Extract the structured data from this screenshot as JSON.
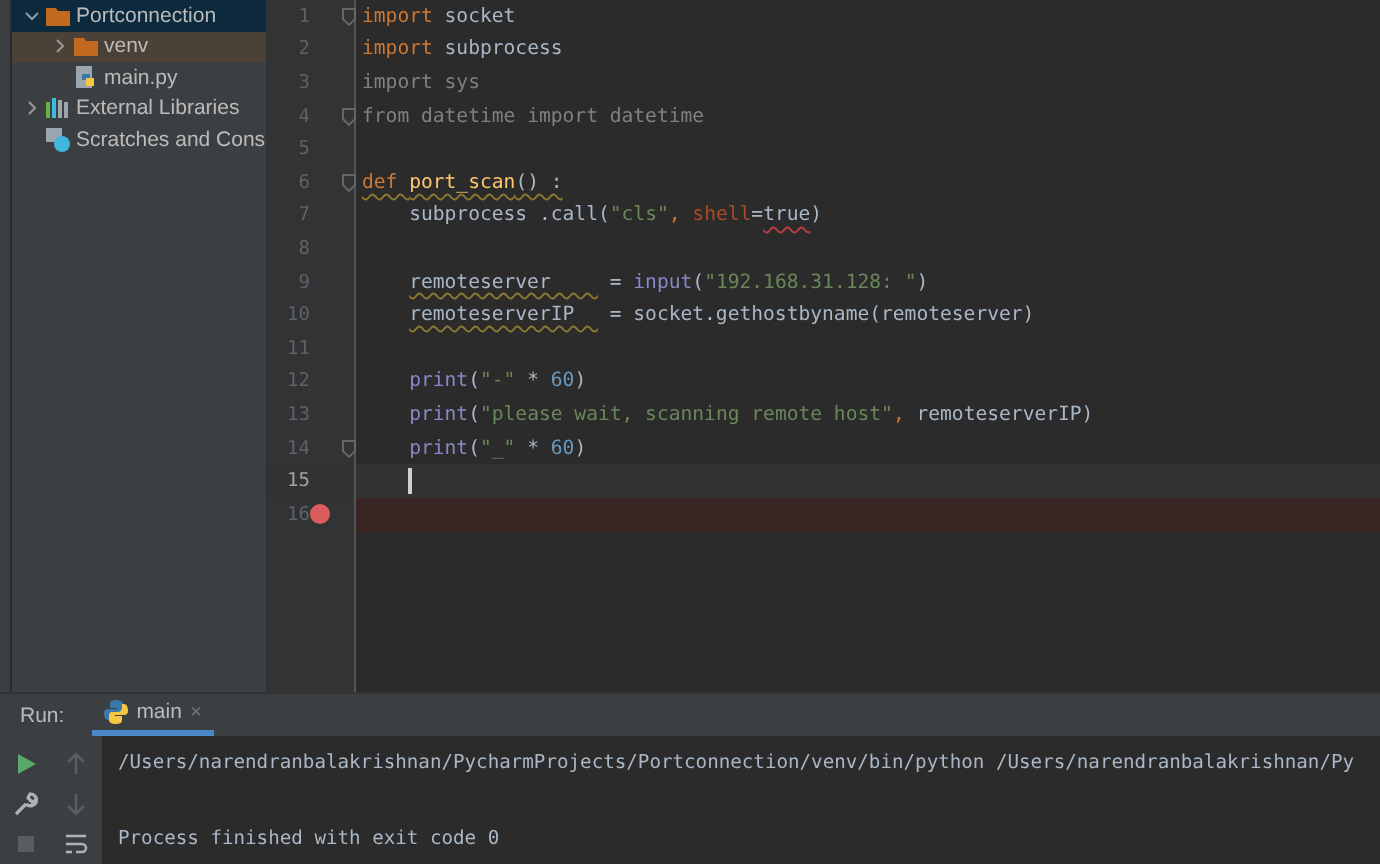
{
  "project_tree": [
    {
      "label": "Portconnection",
      "kind": "folder",
      "expanded": true,
      "selected": true,
      "children": [
        {
          "label": "venv",
          "kind": "folder",
          "expanded": false,
          "selected": false,
          "highlighted": true
        },
        {
          "label": "main.py",
          "kind": "python",
          "selected": false
        }
      ]
    },
    {
      "label": "External Libraries",
      "kind": "library",
      "expanded": false,
      "selected": false
    },
    {
      "label": "Scratches and Cons",
      "kind": "scratch",
      "selected": false
    }
  ],
  "editor": {
    "lines": [
      {
        "number": "1",
        "fold": true,
        "tokens": [
          {
            "text": "import",
            "kind": "keyword"
          },
          {
            "text": " socket",
            "kind": "plain"
          }
        ]
      },
      {
        "number": "2",
        "tokens": [
          {
            "text": "import",
            "kind": "keyword"
          },
          {
            "text": " subprocess",
            "kind": "plain"
          }
        ]
      },
      {
        "number": "3",
        "tokens": [
          {
            "text": "import sys",
            "kind": "unused"
          }
        ]
      },
      {
        "number": "4",
        "fold": true,
        "tokens": [
          {
            "text": "from datetime import datetime",
            "kind": "unused"
          }
        ]
      },
      {
        "number": "5"
      },
      {
        "number": "6",
        "fold": true,
        "tokens": [
          {
            "text": "def ",
            "kind": "keyword_warn"
          },
          {
            "text": "port_scan",
            "kind": "function_warn"
          },
          {
            "text": "() :",
            "kind": "plain_warn"
          }
        ]
      },
      {
        "number": "7",
        "tokens": [
          {
            "text": "    subprocess .call(",
            "kind": "plain"
          },
          {
            "text": "\"cls\"",
            "kind": "string"
          },
          {
            "text": ", ",
            "kind": "keyword"
          },
          {
            "text": "shell",
            "kind": "param"
          },
          {
            "text": "=",
            "kind": "plain"
          },
          {
            "text": "true",
            "kind": "error"
          },
          {
            "text": ")",
            "kind": "plain"
          }
        ]
      },
      {
        "number": "8"
      },
      {
        "number": "9",
        "indented": true,
        "tokens": [
          {
            "text": "remoteserver    ",
            "kind": "plain_warn"
          },
          {
            "text": " = ",
            "kind": "plain"
          },
          {
            "text": "input",
            "kind": "builtin"
          },
          {
            "text": "(",
            "kind": "plain"
          },
          {
            "text": "\"192.168.31.128: \"",
            "kind": "string"
          },
          {
            "text": ")",
            "kind": "plain"
          }
        ]
      },
      {
        "number": "10",
        "indented": true,
        "tokens": [
          {
            "text": "remoteserverIP  ",
            "kind": "plain_warn"
          },
          {
            "text": " = socket.gethostbyname(remoteserver)",
            "kind": "plain"
          }
        ]
      },
      {
        "number": "11"
      },
      {
        "number": "12",
        "indented": true,
        "tokens": [
          {
            "text": "print",
            "kind": "builtin"
          },
          {
            "text": "(",
            "kind": "plain"
          },
          {
            "text": "\"-\"",
            "kind": "string"
          },
          {
            "text": " * ",
            "kind": "plain"
          },
          {
            "text": "60",
            "kind": "number"
          },
          {
            "text": ")",
            "kind": "plain"
          }
        ]
      },
      {
        "number": "13",
        "indented": true,
        "tokens": [
          {
            "text": "print",
            "kind": "builtin"
          },
          {
            "text": "(",
            "kind": "plain"
          },
          {
            "text": "\"please wait, scanning remote host\"",
            "kind": "string"
          },
          {
            "text": ", ",
            "kind": "keyword"
          },
          {
            "text": "remoteserverIP)",
            "kind": "plain"
          }
        ]
      },
      {
        "number": "14",
        "fold": true,
        "indented": true,
        "tokens": [
          {
            "text": "print",
            "kind": "builtin"
          },
          {
            "text": "(",
            "kind": "plain"
          },
          {
            "text": "\"_\"",
            "kind": "string"
          },
          {
            "text": " * ",
            "kind": "plain"
          },
          {
            "text": "60",
            "kind": "number"
          },
          {
            "text": ")",
            "kind": "plain"
          }
        ]
      },
      {
        "number": "15",
        "current": true,
        "caret": true
      },
      {
        "number": "16",
        "breakpoint": true
      }
    ]
  },
  "run_panel": {
    "label": "Run:",
    "tabs": [
      {
        "label": "main",
        "selected": true,
        "close": "×"
      }
    ],
    "console": [
      "/Users/narendranbalakrishnan/PycharmProjects/Portconnection/venv/bin/python /Users/narendranbalakrishnan/Py",
      "Process finished with exit code 0"
    ]
  }
}
